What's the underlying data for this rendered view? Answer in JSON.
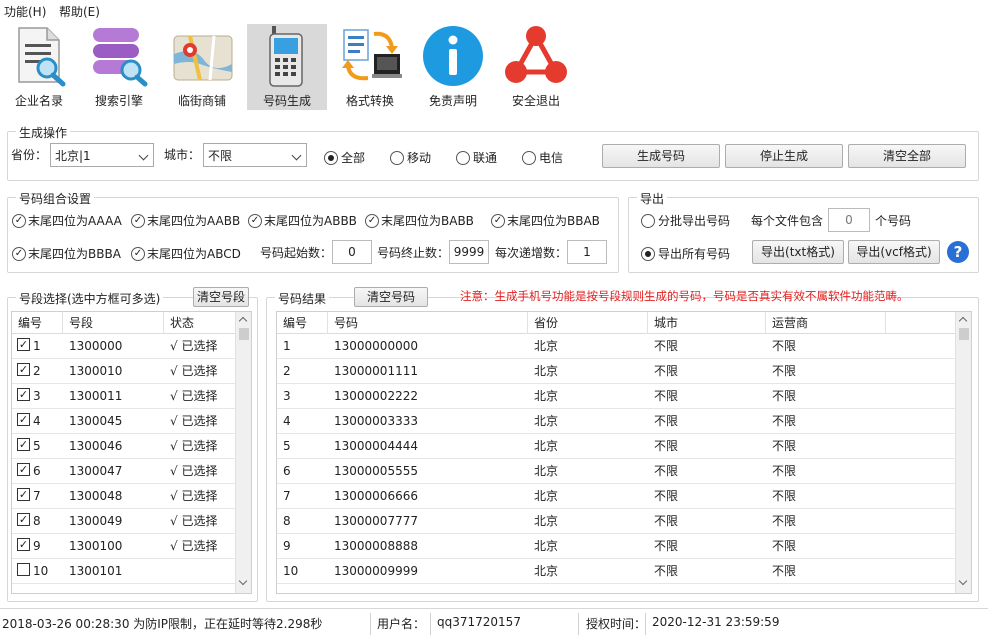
{
  "menu": {
    "items": [
      "功能(H)",
      "帮助(E)"
    ]
  },
  "toolbar": {
    "items": [
      {
        "label": "企业名录",
        "icon": "document-search-icon"
      },
      {
        "label": "搜索引擎",
        "icon": "database-search-icon"
      },
      {
        "label": "临街商铺",
        "icon": "map-icon"
      },
      {
        "label": "号码生成",
        "icon": "phone-icon"
      },
      {
        "label": "格式转换",
        "icon": "convert-icon"
      },
      {
        "label": "免责声明",
        "icon": "info-icon"
      },
      {
        "label": "安全退出",
        "icon": "exit-network-icon"
      }
    ],
    "active_index": 3
  },
  "generate": {
    "title": "生成操作",
    "province_label": "省份：",
    "province_value": "北京|1",
    "city_label": "城市：",
    "city_value": "不限",
    "carriers": [
      "全部",
      "移动",
      "联通",
      "电信"
    ],
    "carrier_selected": 0,
    "buttons": {
      "generate": "生成号码",
      "stop": "停止生成",
      "clear_all": "清空全部"
    }
  },
  "combo": {
    "title": "号码组合设置",
    "options_row1": [
      "末尾四位为AAAA",
      "末尾四位为AABB",
      "末尾四位为ABBB",
      "末尾四位为BABB",
      "末尾四位为BBAB"
    ],
    "options_row2": [
      "末尾四位为BBBA",
      "末尾四位为ABCD"
    ],
    "start_label": "号码起始数：",
    "start_value": "0",
    "end_label": "号码终止数：",
    "end_value": "9999",
    "step_label": "每次递增数：",
    "step_value": "1"
  },
  "export": {
    "title": "导出",
    "batch_label": "分批导出号码",
    "per_file_label": "每个文件包含",
    "per_file_value": "0",
    "per_file_unit": "个号码",
    "all_label": "导出所有号码",
    "txt_button": "导出(txt格式)",
    "vcf_button": "导出(vcf格式)",
    "help_icon": "help-icon",
    "selected": 1
  },
  "segments": {
    "title": "号段选择(选中方框可多选)",
    "clear_button": "清空号段",
    "columns": [
      "编号",
      "号段",
      "状态"
    ],
    "rows": [
      {
        "no": "1",
        "seg": "1300000",
        "status": "√ 已选择",
        "checked": true
      },
      {
        "no": "2",
        "seg": "1300010",
        "status": "√ 已选择",
        "checked": true
      },
      {
        "no": "3",
        "seg": "1300011",
        "status": "√ 已选择",
        "checked": true
      },
      {
        "no": "4",
        "seg": "1300045",
        "status": "√ 已选择",
        "checked": true
      },
      {
        "no": "5",
        "seg": "1300046",
        "status": "√ 已选择",
        "checked": true
      },
      {
        "no": "6",
        "seg": "1300047",
        "status": "√ 已选择",
        "checked": true
      },
      {
        "no": "7",
        "seg": "1300048",
        "status": "√ 已选择",
        "checked": true
      },
      {
        "no": "8",
        "seg": "1300049",
        "status": "√ 已选择",
        "checked": true
      },
      {
        "no": "9",
        "seg": "1300100",
        "status": "√ 已选择",
        "checked": true
      },
      {
        "no": "10",
        "seg": "1300101",
        "status": "",
        "checked": false
      }
    ]
  },
  "results": {
    "title": "号码结果",
    "clear_button": "清空号码",
    "notice": "注意：生成手机号功能是按号段规则生成的号码，号码是否真实有效不属软件功能范畴。",
    "notice_color": "#e02020",
    "columns": [
      "编号",
      "号码",
      "省份",
      "城市",
      "运营商"
    ],
    "rows": [
      {
        "no": "1",
        "num": "13000000000",
        "prov": "北京",
        "city": "不限",
        "carrier": "不限"
      },
      {
        "no": "2",
        "num": "13000001111",
        "prov": "北京",
        "city": "不限",
        "carrier": "不限"
      },
      {
        "no": "3",
        "num": "13000002222",
        "prov": "北京",
        "city": "不限",
        "carrier": "不限"
      },
      {
        "no": "4",
        "num": "13000003333",
        "prov": "北京",
        "city": "不限",
        "carrier": "不限"
      },
      {
        "no": "5",
        "num": "13000004444",
        "prov": "北京",
        "city": "不限",
        "carrier": "不限"
      },
      {
        "no": "6",
        "num": "13000005555",
        "prov": "北京",
        "city": "不限",
        "carrier": "不限"
      },
      {
        "no": "7",
        "num": "13000006666",
        "prov": "北京",
        "city": "不限",
        "carrier": "不限"
      },
      {
        "no": "8",
        "num": "13000007777",
        "prov": "北京",
        "city": "不限",
        "carrier": "不限"
      },
      {
        "no": "9",
        "num": "13000008888",
        "prov": "北京",
        "city": "不限",
        "carrier": "不限"
      },
      {
        "no": "10",
        "num": "13000009999",
        "prov": "北京",
        "city": "不限",
        "carrier": "不限"
      }
    ]
  },
  "status": {
    "message": "2018-03-26 00:28:30 为防IP限制，正在延时等待2.298秒",
    "user_label": "用户名：",
    "user_value": "qq371720157",
    "auth_label": "授权时间：",
    "auth_value": "2020-12-31 23:59:59"
  }
}
